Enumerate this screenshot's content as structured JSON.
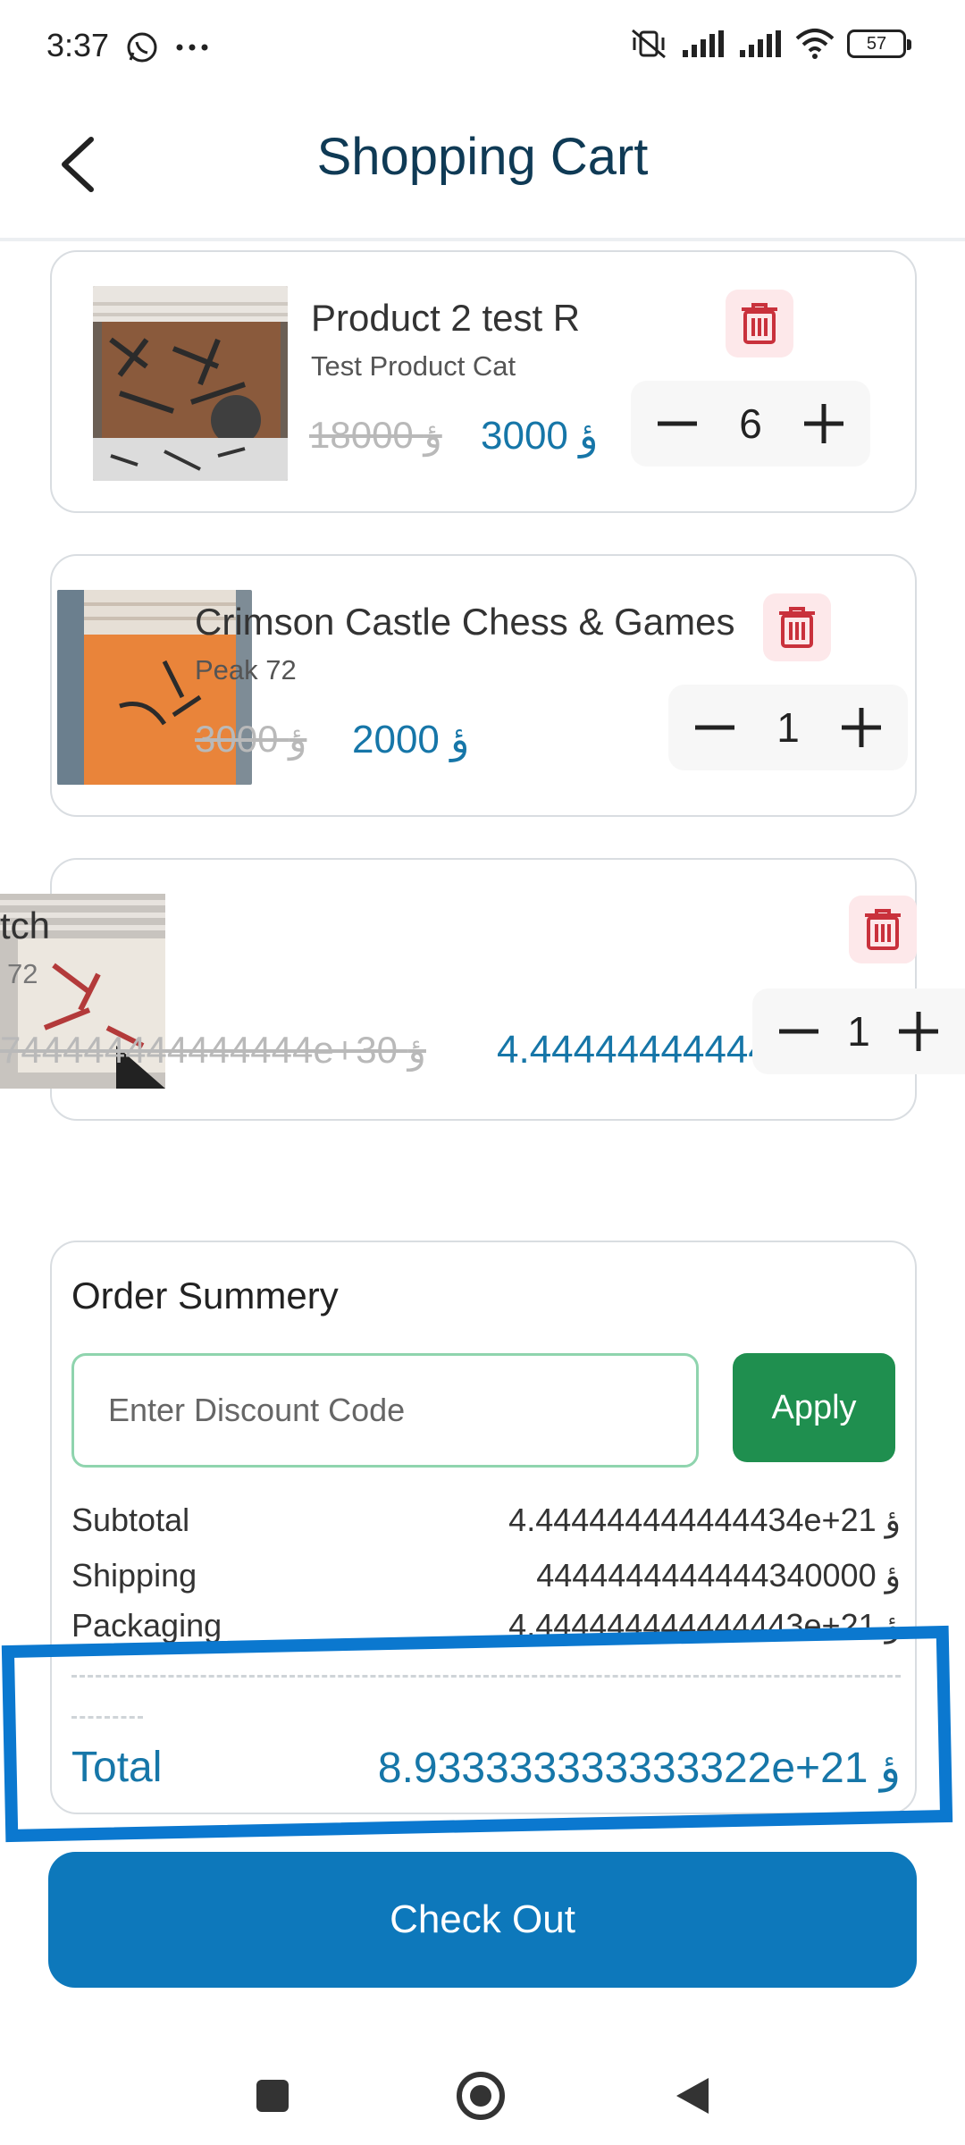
{
  "status_bar": {
    "time": "3:37",
    "battery": "57"
  },
  "header": {
    "title": "Shopping Cart"
  },
  "currency_symbol": "ؤ",
  "cart_items": [
    {
      "name": "Product 2 test R",
      "category": "Test Product Cat",
      "old_price": "18000 ؤ",
      "new_price": "3000 ؤ",
      "quantity": "6"
    },
    {
      "name": "Crimson Castle Chess & Games",
      "category": "Peak 72",
      "old_price": "3000 ؤ",
      "new_price": "2000 ؤ",
      "quantity": "1"
    },
    {
      "name": "tch",
      "category": "72",
      "old_price": "744444444444444e+30 ؤ",
      "new_price": "4.44444444444",
      "quantity": "1"
    }
  ],
  "summary": {
    "title": "Order Summery",
    "discount_placeholder": "Enter Discount Code",
    "apply_label": "Apply",
    "subtotal_label": "Subtotal",
    "subtotal_value": "4.444444444444434e+21 ؤ",
    "shipping_label": "Shipping",
    "shipping_value": "4444444444444340000 ؤ",
    "packaging_label": "Packaging",
    "packaging_value": "4.444444444444443e+21 ؤ",
    "total_label": "Total",
    "total_value": "8.933333333333322e+21 ؤ"
  },
  "checkout_label": "Check Out",
  "colors": {
    "accent_blue": "#0d78bb",
    "price_blue": "#1676a8",
    "title_navy": "#0f3a55",
    "apply_green": "#1f8f4f",
    "trash_red": "#c9313c",
    "highlight_blue": "#0b78cf"
  },
  "icons": {
    "back": "chevron-left-icon",
    "delete": "trash-icon",
    "minus": "minus-icon",
    "plus": "plus-icon"
  }
}
